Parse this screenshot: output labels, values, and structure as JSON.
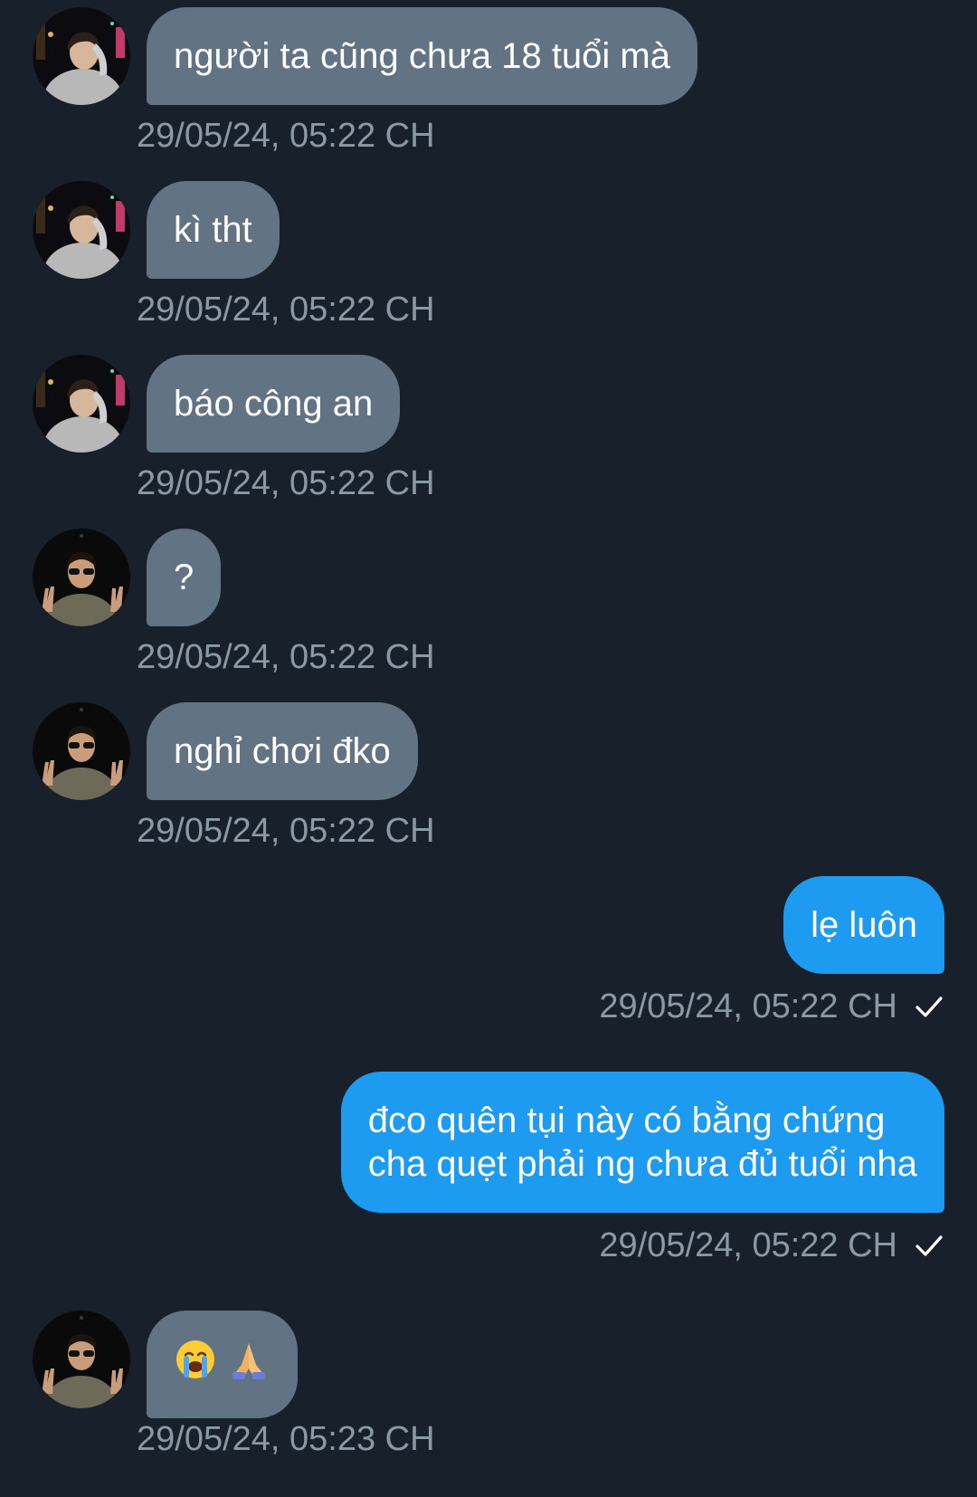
{
  "messages": [
    {
      "direction": "in",
      "avatar": "avatar-hand-on-head",
      "text": "người ta cũng chưa 18 tuổi mà",
      "time": "29/05/24, 05:22 CH"
    },
    {
      "direction": "in",
      "avatar": "avatar-hand-on-head",
      "text": "kì tht",
      "time": "29/05/24, 05:22 CH"
    },
    {
      "direction": "in",
      "avatar": "avatar-hand-on-head",
      "text": "báo công an",
      "time": "29/05/24, 05:22 CH"
    },
    {
      "direction": "in",
      "avatar": "avatar-peace-sign",
      "text": "?",
      "time": "29/05/24, 05:22 CH"
    },
    {
      "direction": "in",
      "avatar": "avatar-peace-sign",
      "text": "nghỉ chơi đko",
      "time": "29/05/24, 05:22 CH"
    },
    {
      "direction": "out",
      "text": "lẹ luôn",
      "time": "29/05/24, 05:22 CH",
      "status_icon": "check-icon"
    },
    {
      "direction": "out",
      "text_lines": [
        "đco quên tụi này có bằng chứng",
        "cha quẹt phải ng chưa đủ tuổi nha"
      ],
      "time": "29/05/24, 05:22 CH",
      "status_icon": "check-icon"
    },
    {
      "direction": "in",
      "avatar": "avatar-peace-sign",
      "emojis": [
        "loudly-crying-face-icon",
        "folded-hands-icon"
      ],
      "time": "29/05/24, 05:23 CH"
    }
  ],
  "colors": {
    "background": "#18202b",
    "incoming_bubble": "#627384",
    "outgoing_bubble": "#1d9bf0",
    "timestamp": "#8b98a5",
    "text": "#ffffff"
  }
}
